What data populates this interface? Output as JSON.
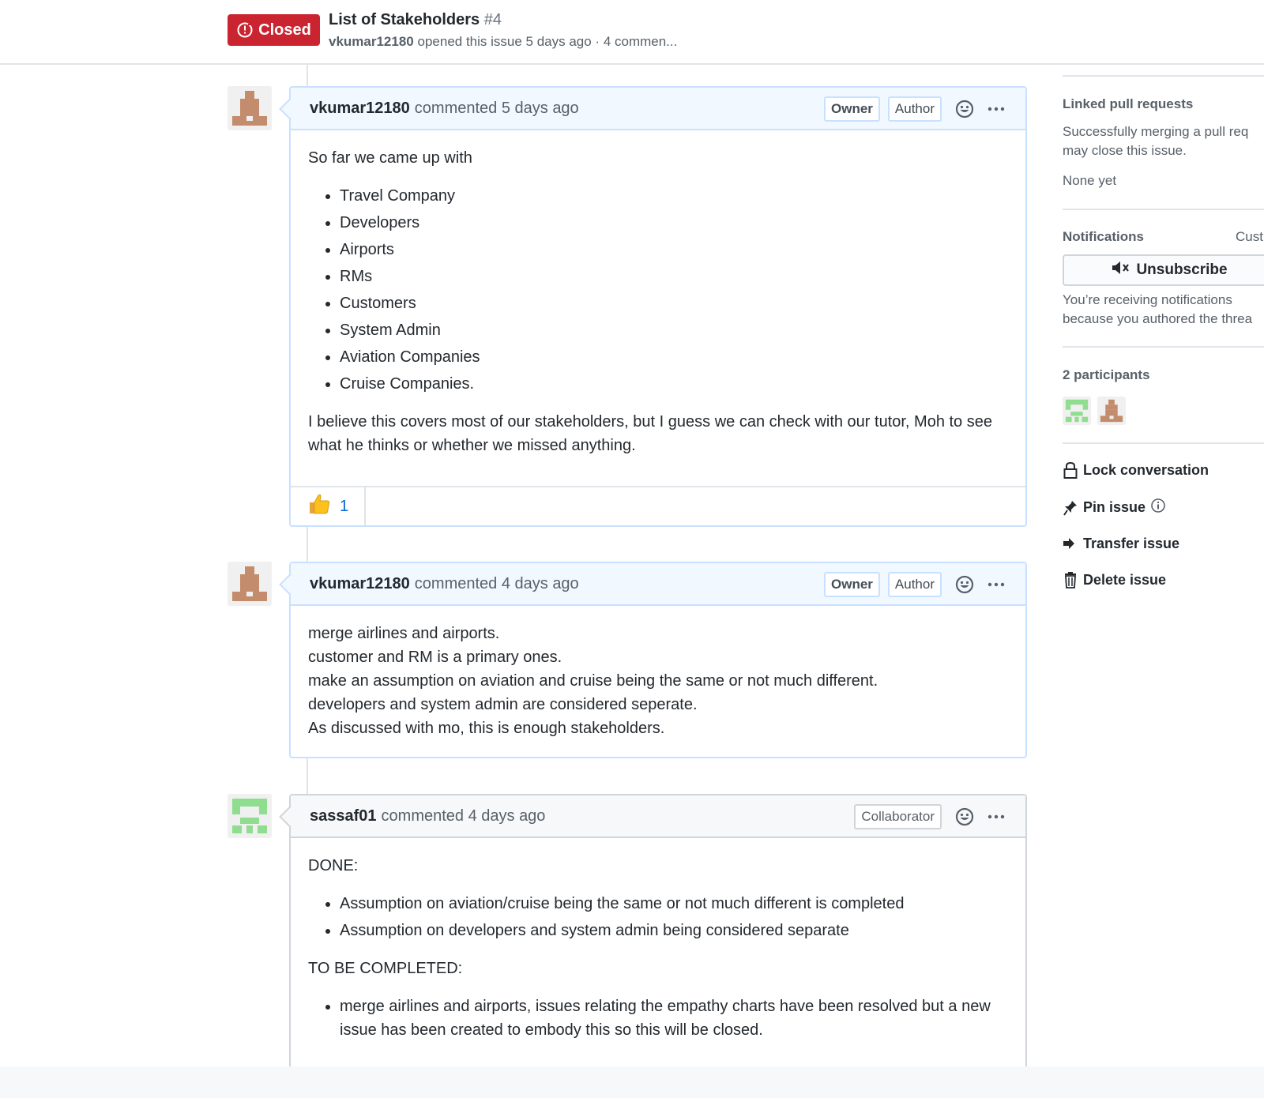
{
  "header": {
    "state_label": "Closed",
    "title": "List of Stakeholders",
    "number": "#4",
    "author": "vkumar12180",
    "meta_text": "opened this issue 5 days ago · 4 commen..."
  },
  "comments": [
    {
      "author": "vkumar12180",
      "timestamp": "commented 5 days ago",
      "labels": [
        "Owner",
        "Author"
      ],
      "intro": "So far we came up with",
      "items": [
        "Travel Company",
        "Developers",
        "Airports",
        "RMs",
        "Customers",
        "System Admin",
        "Aviation Companies",
        "Cruise Companies."
      ],
      "outro": "I believe this covers most of our stakeholders, but I guess we can check with our tutor, Moh to see what he thinks or whether we missed anything.",
      "reaction_count": "1"
    },
    {
      "author": "vkumar12180",
      "timestamp": "commented 4 days ago",
      "labels": [
        "Owner",
        "Author"
      ],
      "lines": [
        "merge airlines and airports.",
        "customer and RM is a primary ones.",
        "make an assumption on aviation and cruise being the same or not much different.",
        "developers and system admin are considered seperate.",
        "As discussed with mo, this is enough stakeholders."
      ]
    },
    {
      "author": "sassaf01",
      "timestamp": "commented 4 days ago",
      "labels": [
        "Collaborator"
      ],
      "done_heading": "DONE:",
      "done_items": [
        "Assumption on aviation/cruise being the same or not much different is completed",
        "Assumption on developers and system admin being considered separate"
      ],
      "todo_heading": "TO BE COMPLETED:",
      "todo_items": [
        "merge airlines and airports, issues relating the empathy charts have been resolved but a new issue has been created to embody this so this will be closed."
      ]
    }
  ],
  "sidebar": {
    "linked_prs_heading": "Linked pull requests",
    "linked_prs_text_1": "Successfully merging a pull req",
    "linked_prs_text_2": "may close this issue.",
    "linked_prs_none": "None yet",
    "notifications_heading": "Notifications",
    "notifications_customize": "Cust",
    "unsubscribe_label": "Unsubscribe",
    "notifications_text_1": "You’re receiving notifications",
    "notifications_text_2": "because you authored the threa",
    "participants_heading": "2 participants",
    "actions": {
      "lock": "Lock conversation",
      "pin": "Pin issue",
      "transfer": "Transfer issue",
      "delete": "Delete issue"
    }
  },
  "colors": {
    "closed_red": "#cb2431",
    "link_blue": "#0366d6",
    "owner_header_bg": "#f1f8ff",
    "avatar_brown": "#c38c6c",
    "avatar_green": "#8fdd8f"
  },
  "icons": [
    "issue-closed-icon",
    "smiley-icon",
    "kebab-icon",
    "thumbsup-icon",
    "mute-icon",
    "lock-icon",
    "pin-icon",
    "info-icon",
    "arrow-right-icon",
    "trashcan-icon"
  ]
}
